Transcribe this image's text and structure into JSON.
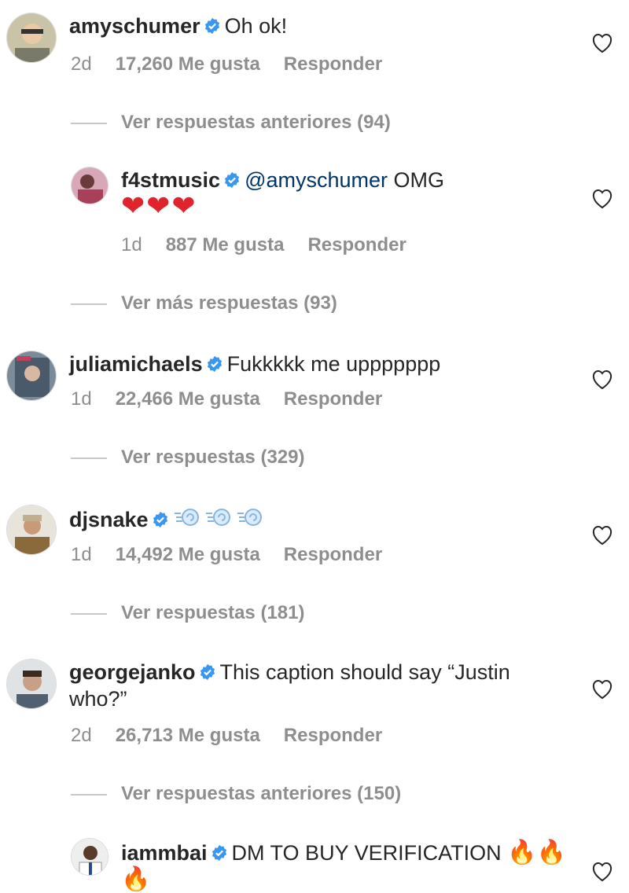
{
  "comments": [
    {
      "username": "amyschumer",
      "text": "Oh ok!",
      "age": "2d",
      "likes": "17,260 Me gusta",
      "reply": "Responder",
      "view_replies": "Ver respuestas anteriores (94)"
    },
    {
      "username": "f4stmusic",
      "mention": "@amyschumer",
      "text": "OMG",
      "emoji": "❤❤❤",
      "age": "1d",
      "likes": "887 Me gusta",
      "reply": "Responder",
      "view_replies": "Ver más respuestas (93)"
    },
    {
      "username": "juliamichaels",
      "text": "Fukkkkk me uppppppp",
      "age": "1d",
      "likes": "22,466 Me gusta",
      "reply": "Responder",
      "view_replies": "Ver respuestas (329)"
    },
    {
      "username": "djsnake",
      "age": "1d",
      "likes": "14,492 Me gusta",
      "reply": "Responder",
      "view_replies": "Ver respuestas (181)"
    },
    {
      "username": "georgejanko",
      "text": "This caption should say “Justin who?”",
      "age": "2d",
      "likes": "26,713 Me gusta",
      "reply": "Responder",
      "view_replies": "Ver respuestas anteriores (150)"
    },
    {
      "username": "iammbai",
      "text": "DM TO BUY VERIFICATION",
      "emoji": "🔥🔥🔥"
    }
  ],
  "colors": {
    "verified": "#3897f0",
    "muted": "#8e8e8e",
    "text": "#262626",
    "mention": "#003569"
  }
}
